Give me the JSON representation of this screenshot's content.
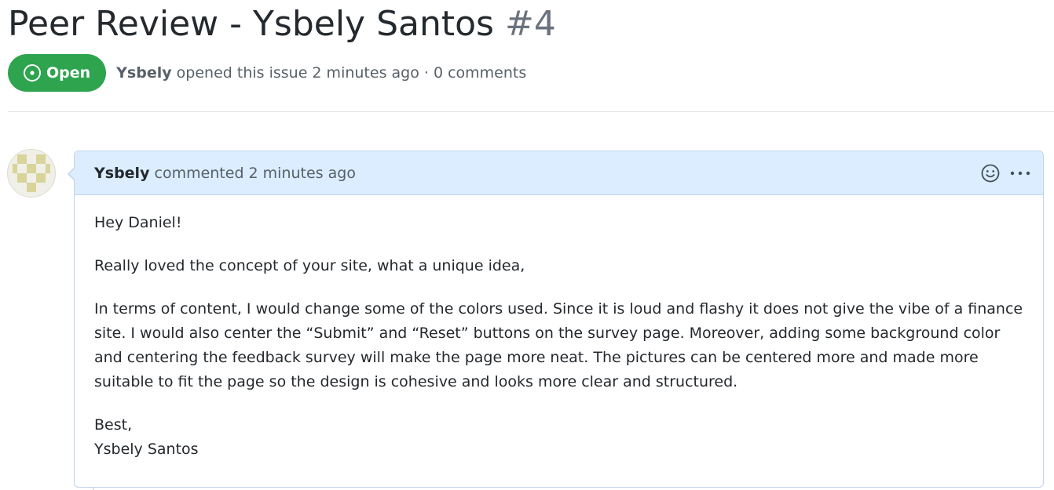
{
  "issue": {
    "title": "Peer Review - Ysbely Santos",
    "number": "#4",
    "state_label": "Open",
    "author": "Ysbely",
    "meta_text": " opened this issue 2 minutes ago · 0 comments"
  },
  "comment": {
    "author": "Ysbely",
    "meta_text": " commented 2 minutes ago",
    "body": {
      "greeting": "Hey Daniel!",
      "paragraph_1": "Really loved the concept of your site, what a unique idea,",
      "paragraph_2": "In terms of content, I would change some of the colors used. Since it is loud and flashy it does not give the vibe of a finance site. I would also center the “Submit” and “Reset” buttons on the survey page. Moreover, adding some background color and centering the feedback survey will make the page more neat. The pictures can be centered more and made more suitable to fit the page so the design is cohesive and looks more clear and structured.",
      "closing": "Best,",
      "signature": "Ysbely Santos"
    },
    "icons": {
      "reaction": "smiley-icon",
      "menu": "kebab-horizontal-icon"
    }
  },
  "colors": {
    "open_badge": "#2ea44f",
    "comment_header_bg": "#dbedff",
    "comment_border": "#c0d3eb",
    "avatar_pattern": "#d8d49a"
  }
}
